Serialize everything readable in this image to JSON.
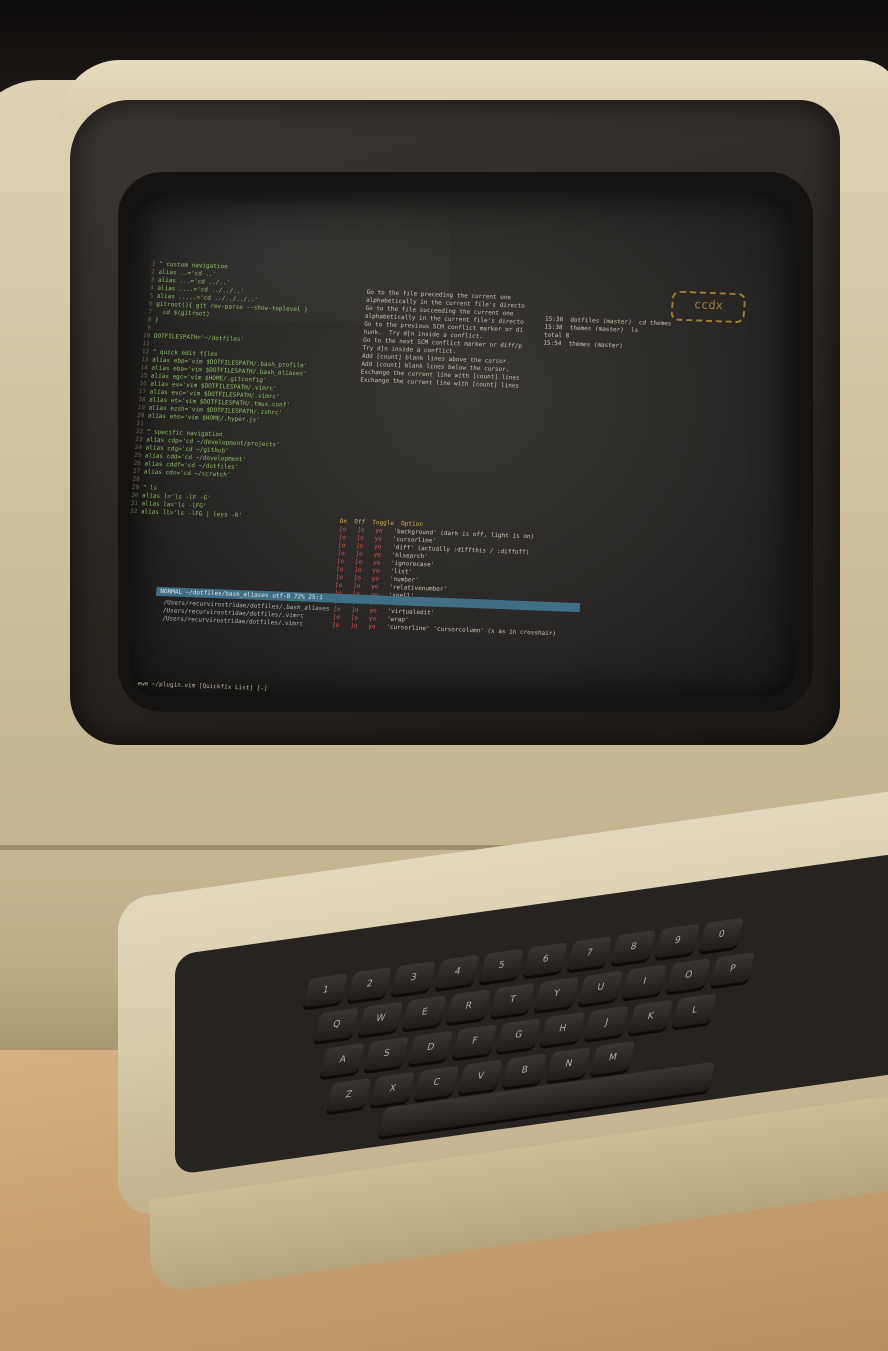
{
  "screen": {
    "left_pane": [
      "\" custom navigation",
      "alias ..='cd ..'",
      "alias ...='cd ../..'",
      "alias ....='cd ../../..'",
      "alias .....='cd ../../../..'",
      "gitroot(){ git rev-parse --show-toplevel }",
      "  cd $(gitroot)",
      "}",
      "",
      "DOTFILESPATH='~/dotfiles'",
      "",
      "\" quick edit files",
      "alias ebp='vim $DOTFILESPATH/.bash_profile'",
      "alias eba='vim $DOTFILESPATH/.bash_aliases'",
      "alias egc='vim $HOME/.gitconfig'",
      "alias ev='vim $DOTFILESPATH/.vimrc'",
      "alias evc='vim $DOTFILESPATH/.vimrc'",
      "alias et='vim $DOTFILESPATH/.tmux.conf'",
      "alias ezsh='vim $DOTFILESPATH/.zshrc'",
      "alias ehs='vim $HOME/.hyper.js'",
      "",
      "\" specific navigation",
      "alias cdp='cd ~/development/projects'",
      "alias cdg='cd ~/github'",
      "alias cdd='cd ~/development'",
      "alias cddf='cd ~/dotfiles'",
      "alias cds='cd ~/scratch'",
      "",
      "\" ls",
      "alias l='ls -lF -G'",
      "alias la='ls -lFG'",
      "alias ll='ls -lFG | less -R'"
    ],
    "status_line": "NORMAL  ~/dotfiles/bash_aliases  utf-8  72%  25:1",
    "path_lines": [
      "/Users/recurvirostridae/dotfiles/.bash_aliases",
      "/Users/recurvirostridae/dotfiles/.vimrc",
      "/Users/recurvirostridae/dotfiles/.vimrc"
    ],
    "bottom_line": "ewe ~/plugin.vim  [Quickfix List] [-]",
    "help_pane": [
      "Go to the file preceding the current one",
      "alphabetically in the current file's directo",
      "",
      "Go to the file succeeding the current one",
      "alphabetically in the current file's directo",
      "",
      "Go to the previous SCM conflict marker or di",
      "hunk.  Try d[n inside a conflict.",
      "",
      "Go to the next SCM conflict marker or diff/p",
      "Try d]n inside a conflict.",
      "",
      "Add [count] blank lines above the cursor.",
      "",
      "Add [count] blank lines below the cursor.",
      "",
      "Exchange the current line with [count] lines",
      "",
      "Exchange the current line with [count] lines"
    ],
    "option_header": "On  Off  Toggle  Option",
    "option_rows": [
      "'background' (dark is off, light is on)",
      "'cursorline'",
      "'diff' (actually :diffthis / :diffoff)",
      "'hlsearch'",
      "'ignorecase'",
      "'list'",
      "'number'",
      "'relativenumber'",
      "'spell'",
      "'cursorcolumn'",
      "'virtualedit'",
      "'wrap'",
      "'cursorline' 'cursorcolumn' (x as in crosshair)"
    ],
    "prompt": [
      "15:38  dotfiles (master)  cd themes",
      "15:38  themes (master)  ls",
      "total 8",
      "15:54  themes (master)"
    ],
    "logo": "ccdx"
  },
  "keyboard": {
    "row1": [
      "1",
      "2",
      "3",
      "4",
      "5",
      "6",
      "7",
      "8",
      "9",
      "0"
    ],
    "row2": [
      "Q",
      "W",
      "E",
      "R",
      "T",
      "Y",
      "U",
      "I",
      "O",
      "P"
    ],
    "row3": [
      "A",
      "S",
      "D",
      "F",
      "G",
      "H",
      "J",
      "K",
      "L"
    ],
    "row4": [
      "Z",
      "X",
      "C",
      "V",
      "B",
      "N",
      "M"
    ]
  }
}
